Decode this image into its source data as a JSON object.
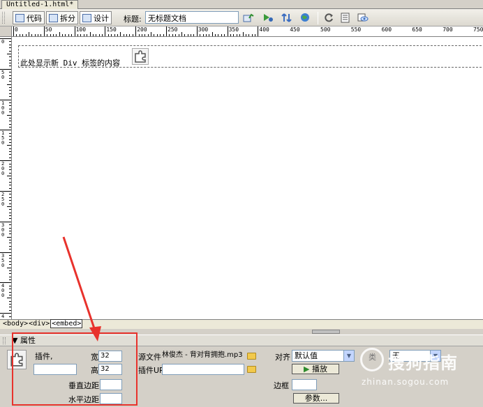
{
  "document_tab": "Untitled-1.html*",
  "toolbar": {
    "code_label": "代码",
    "split_label": "拆分",
    "design_label": "设计",
    "title_label": "标题:",
    "title_value": "无标题文档"
  },
  "ruler": {
    "h_labels": [
      "0",
      "50",
      "100",
      "150",
      "200",
      "250",
      "300",
      "350",
      "400",
      "450",
      "500",
      "550",
      "600",
      "650",
      "700",
      "750"
    ],
    "v_labels": [
      "0",
      "50",
      "100",
      "150",
      "200",
      "250",
      "300",
      "350",
      "400",
      "4"
    ]
  },
  "canvas": {
    "div_placeholder": "此处显示新 Div 标签的内容"
  },
  "statusbar": {
    "tags": [
      "<body>",
      "<div>",
      "<embed>"
    ]
  },
  "properties": {
    "header": "属性",
    "plugin_label": "插件,",
    "width_label": "宽",
    "width_value": "32",
    "height_label": "高",
    "height_value": "32",
    "src_label": "源文件",
    "src_value": "林俊杰 - 背对背拥抱.mp3",
    "plugin_url_label": "插件URL",
    "plugin_url_value": "",
    "align_label": "对齐",
    "align_value": "默认值",
    "play_label": "播放",
    "class_label": "类",
    "class_value": "无",
    "vspace_label": "垂直边距",
    "hspace_label": "水平边距",
    "border_label": "边框",
    "params_label": "参数..."
  },
  "watermark": {
    "brand": "搜狗指南",
    "url": "zhinan.sogou.com"
  },
  "colors": {
    "highlight": "#e8322c",
    "chrome": "#d4d0c8"
  }
}
